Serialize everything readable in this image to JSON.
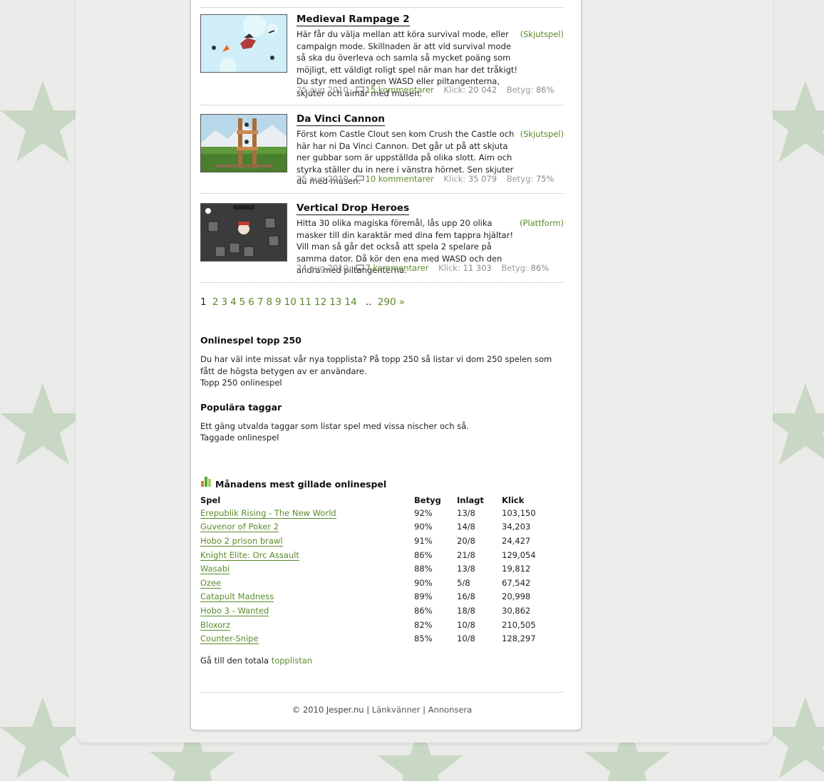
{
  "colors": {
    "link": "#5a8a2a",
    "background": "#e9eae7",
    "star": "#c8d8c3"
  },
  "games": [
    {
      "title": "Medieval Rampage 2",
      "description": "Här får du välja mellan att köra survival mode, eller campaign mode. Skillnaden är att vid survival mode så ska du överleva och samla så mycket poäng som möjligt, ett väldigt roligt spel när man har det tråkigt! Du styr med antingen WASD eller piltangenterna, skjuter och aimar med musen.",
      "category": "(Skjutspel)",
      "date": "25 aug 2010",
      "comments": "15 kommentarer",
      "clicks_label": "Klick:",
      "clicks": "20 042",
      "rating_label": "Betyg:",
      "rating": "86%"
    },
    {
      "title": "Da Vinci Cannon",
      "description": "Först kom Castle Clout sen kom Crush the Castle och här har ni Da Vinci Cannon. Det går ut på att skjuta ner gubbar som är uppställda på olika slott. Aim och styrka ställer du in nere i vänstra hörnet. Sen skjuter du med musen.",
      "category": "(Skjutspel)",
      "date": "25 aug 2010",
      "comments": "10 kommentarer",
      "clicks_label": "Klick:",
      "clicks": "35 079",
      "rating_label": "Betyg:",
      "rating": "75%"
    },
    {
      "title": "Vertical Drop Heroes",
      "description": "Hitta 30 olika magiska föremål, lås upp 20 olika masker till din karaktär med dina fem tappra hjältar! Vill man så går det också att spela 2 spelare på samma dator. Då kör den ena med WASD och den andra med piltangenterna.",
      "category": "(Plattform)",
      "date": "24 aug 2010",
      "comments": "7 kommentarer",
      "clicks_label": "Klick:",
      "clicks": "11 303",
      "rating_label": "Betyg:",
      "rating": "86%"
    }
  ],
  "pager": {
    "current": "1",
    "pages": [
      "2",
      "3",
      "4",
      "5",
      "6",
      "7",
      "8",
      "9",
      "10",
      "11",
      "12",
      "13",
      "14"
    ],
    "ellipsis": "..",
    "last": "290 »"
  },
  "top250": {
    "heading": "Onlinespel topp 250",
    "text": "Du har väl inte missat vår nya topplista? På topp 250 så listar vi dom 250 spelen som fått de högsta betygen av er användare.",
    "link": "Topp 250 onlinespel"
  },
  "tags": {
    "heading": "Populära taggar",
    "text": "Ett gäng utvalda taggar som listar spel med vissa nischer och så.",
    "link": "Taggade onlinespel"
  },
  "monthly": {
    "heading": "Månadens mest gillade onlinespel",
    "columns": [
      "Spel",
      "Betyg",
      "Inlagt",
      "Klick"
    ],
    "rows": [
      [
        "Erepublik Rising - The New World",
        "92%",
        "13/8",
        "103,150"
      ],
      [
        "Guvenor of Poker 2",
        "90%",
        "14/8",
        "34,203"
      ],
      [
        "Hobo 2 prison brawl",
        "91%",
        "20/8",
        "24,427"
      ],
      [
        "Knight Elite: Orc Assault",
        "86%",
        "21/8",
        "129,054"
      ],
      [
        "Wasabi",
        "88%",
        "13/8",
        "19,812"
      ],
      [
        "Ozee",
        "90%",
        "5/8",
        "67,542"
      ],
      [
        "Catapult Madness",
        "89%",
        "16/8",
        "20,998"
      ],
      [
        "Hobo 3 - Wanted",
        "86%",
        "18/8",
        "30,862"
      ],
      [
        "Bloxorz",
        "82%",
        "10/8",
        "210,505"
      ],
      [
        "Counter-Snipe",
        "85%",
        "10/8",
        "128,297"
      ]
    ],
    "footer_text": "Gå till den totala",
    "footer_link": "topplistan"
  },
  "footer": {
    "copyright": "© 2010 Jesper.nu",
    "sep": "|",
    "link1": "Länkvänner",
    "link2": "Annonsera"
  }
}
